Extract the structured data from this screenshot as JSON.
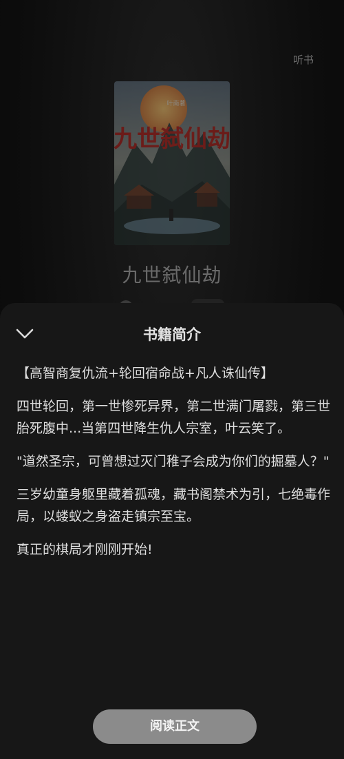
{
  "header": {
    "listen_label": "听书"
  },
  "book": {
    "title": "九世弑仙劫",
    "cover_title": "九世弑仙劫",
    "cover_author": "叶南著"
  },
  "sheet": {
    "title": "书籍简介",
    "paragraphs": [
      "【高智商复仇流+轮回宿命战+凡人诛仙传】",
      "四世轮回，第一世惨死异界，第二世满门屠戮，第三世胎死腹中...当第四世降生仇人宗室，叶云笑了。",
      "\"道然圣宗，可曾想过灭门稚子会成为你们的掘墓人？\"",
      "三岁幼童身躯里藏着孤魂，藏书阁禁术为引，七绝毒作局，以蝼蚁之身盗走镇宗至宝。",
      "真正的棋局才刚刚开始!"
    ],
    "read_button": "阅读正文"
  },
  "colors": {
    "sheet_bg": "#171717",
    "button_bg": "#8b8b8b",
    "cover_title_red": "#b0201a"
  }
}
